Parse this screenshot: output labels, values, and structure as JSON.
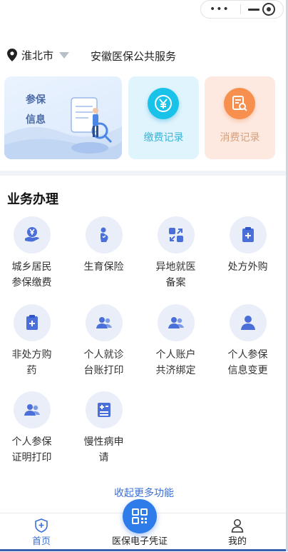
{
  "header": {
    "city": "淮北市",
    "service_title": "安徽医保公共服务"
  },
  "cards": {
    "info": {
      "line1": "参保",
      "line2": "信息"
    },
    "payment": {
      "label": "缴费记录",
      "icon": "yen-icon"
    },
    "spending": {
      "label": "消费记录",
      "icon": "receipt-search-icon"
    }
  },
  "business": {
    "title": "业务办理",
    "items": [
      {
        "line1": "城乡居民",
        "line2": "参保缴费",
        "icon": "hand-yen-icon"
      },
      {
        "line1": "生育保险",
        "line2": "",
        "icon": "pregnant-icon"
      },
      {
        "line1": "异地就医",
        "line2": "备案",
        "icon": "transfer-icon"
      },
      {
        "line1": "处方外购",
        "line2": "",
        "icon": "clipboard-plus-icon"
      },
      {
        "line1": "非处方购",
        "line2": "药",
        "icon": "clipboard-plus-icon"
      },
      {
        "line1": "个人就诊",
        "line2": "台账打印",
        "icon": "users-icon"
      },
      {
        "line1": "个人账户",
        "line2": "共济绑定",
        "icon": "users-icon"
      },
      {
        "line1": "个人参保",
        "line2": "信息变更",
        "icon": "user-icon"
      },
      {
        "line1": "个人参保",
        "line2": "证明打印",
        "icon": "users-icon"
      },
      {
        "line1": "慢性病申",
        "line2": "请",
        "icon": "hospital-icon"
      }
    ],
    "collapse_label": "收起更多功能"
  },
  "tabbar": {
    "home": "首页",
    "qr": "医保电子凭证",
    "mine": "我的"
  },
  "colors": {
    "accent": "#3b6fd6",
    "payment": "#19c2e8",
    "spending": "#f7904f"
  }
}
